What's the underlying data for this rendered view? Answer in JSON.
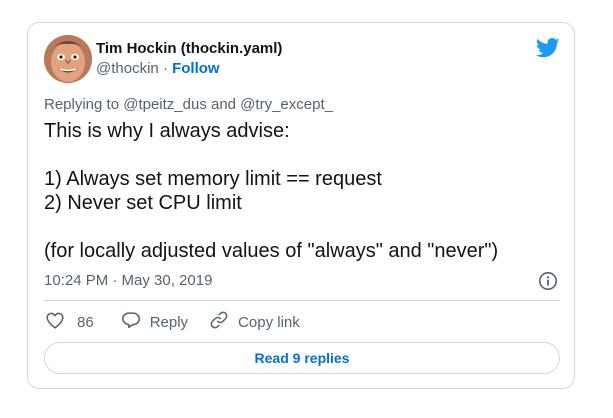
{
  "author": {
    "name": "Tim Hockin (thockin.yaml)",
    "handle": "@thockin",
    "separator": "·",
    "follow_label": "Follow"
  },
  "replying_to": "Replying to @tpeitz_dus and @try_except_",
  "tweet": {
    "lines": [
      "This is why I always advise:",
      "",
      "1) Always set memory limit == request",
      "2) Never set CPU limit",
      "",
      "(for locally adjusted values of \"always\" and \"never\")"
    ]
  },
  "timestamp": "10:24 PM · May 30, 2019",
  "actions": {
    "like_count": "86",
    "reply_label": "Reply",
    "copy_link_label": "Copy link"
  },
  "read_replies_label": "Read 9 replies",
  "colors": {
    "accent": "#006fd6",
    "twitter_blue": "#1d9bf0",
    "secondary_text": "#536471",
    "border": "#cfd9de"
  },
  "icons": [
    "avatar-image",
    "twitter-bird-icon",
    "info-icon",
    "heart-icon",
    "reply-bubble-icon",
    "link-icon"
  ]
}
